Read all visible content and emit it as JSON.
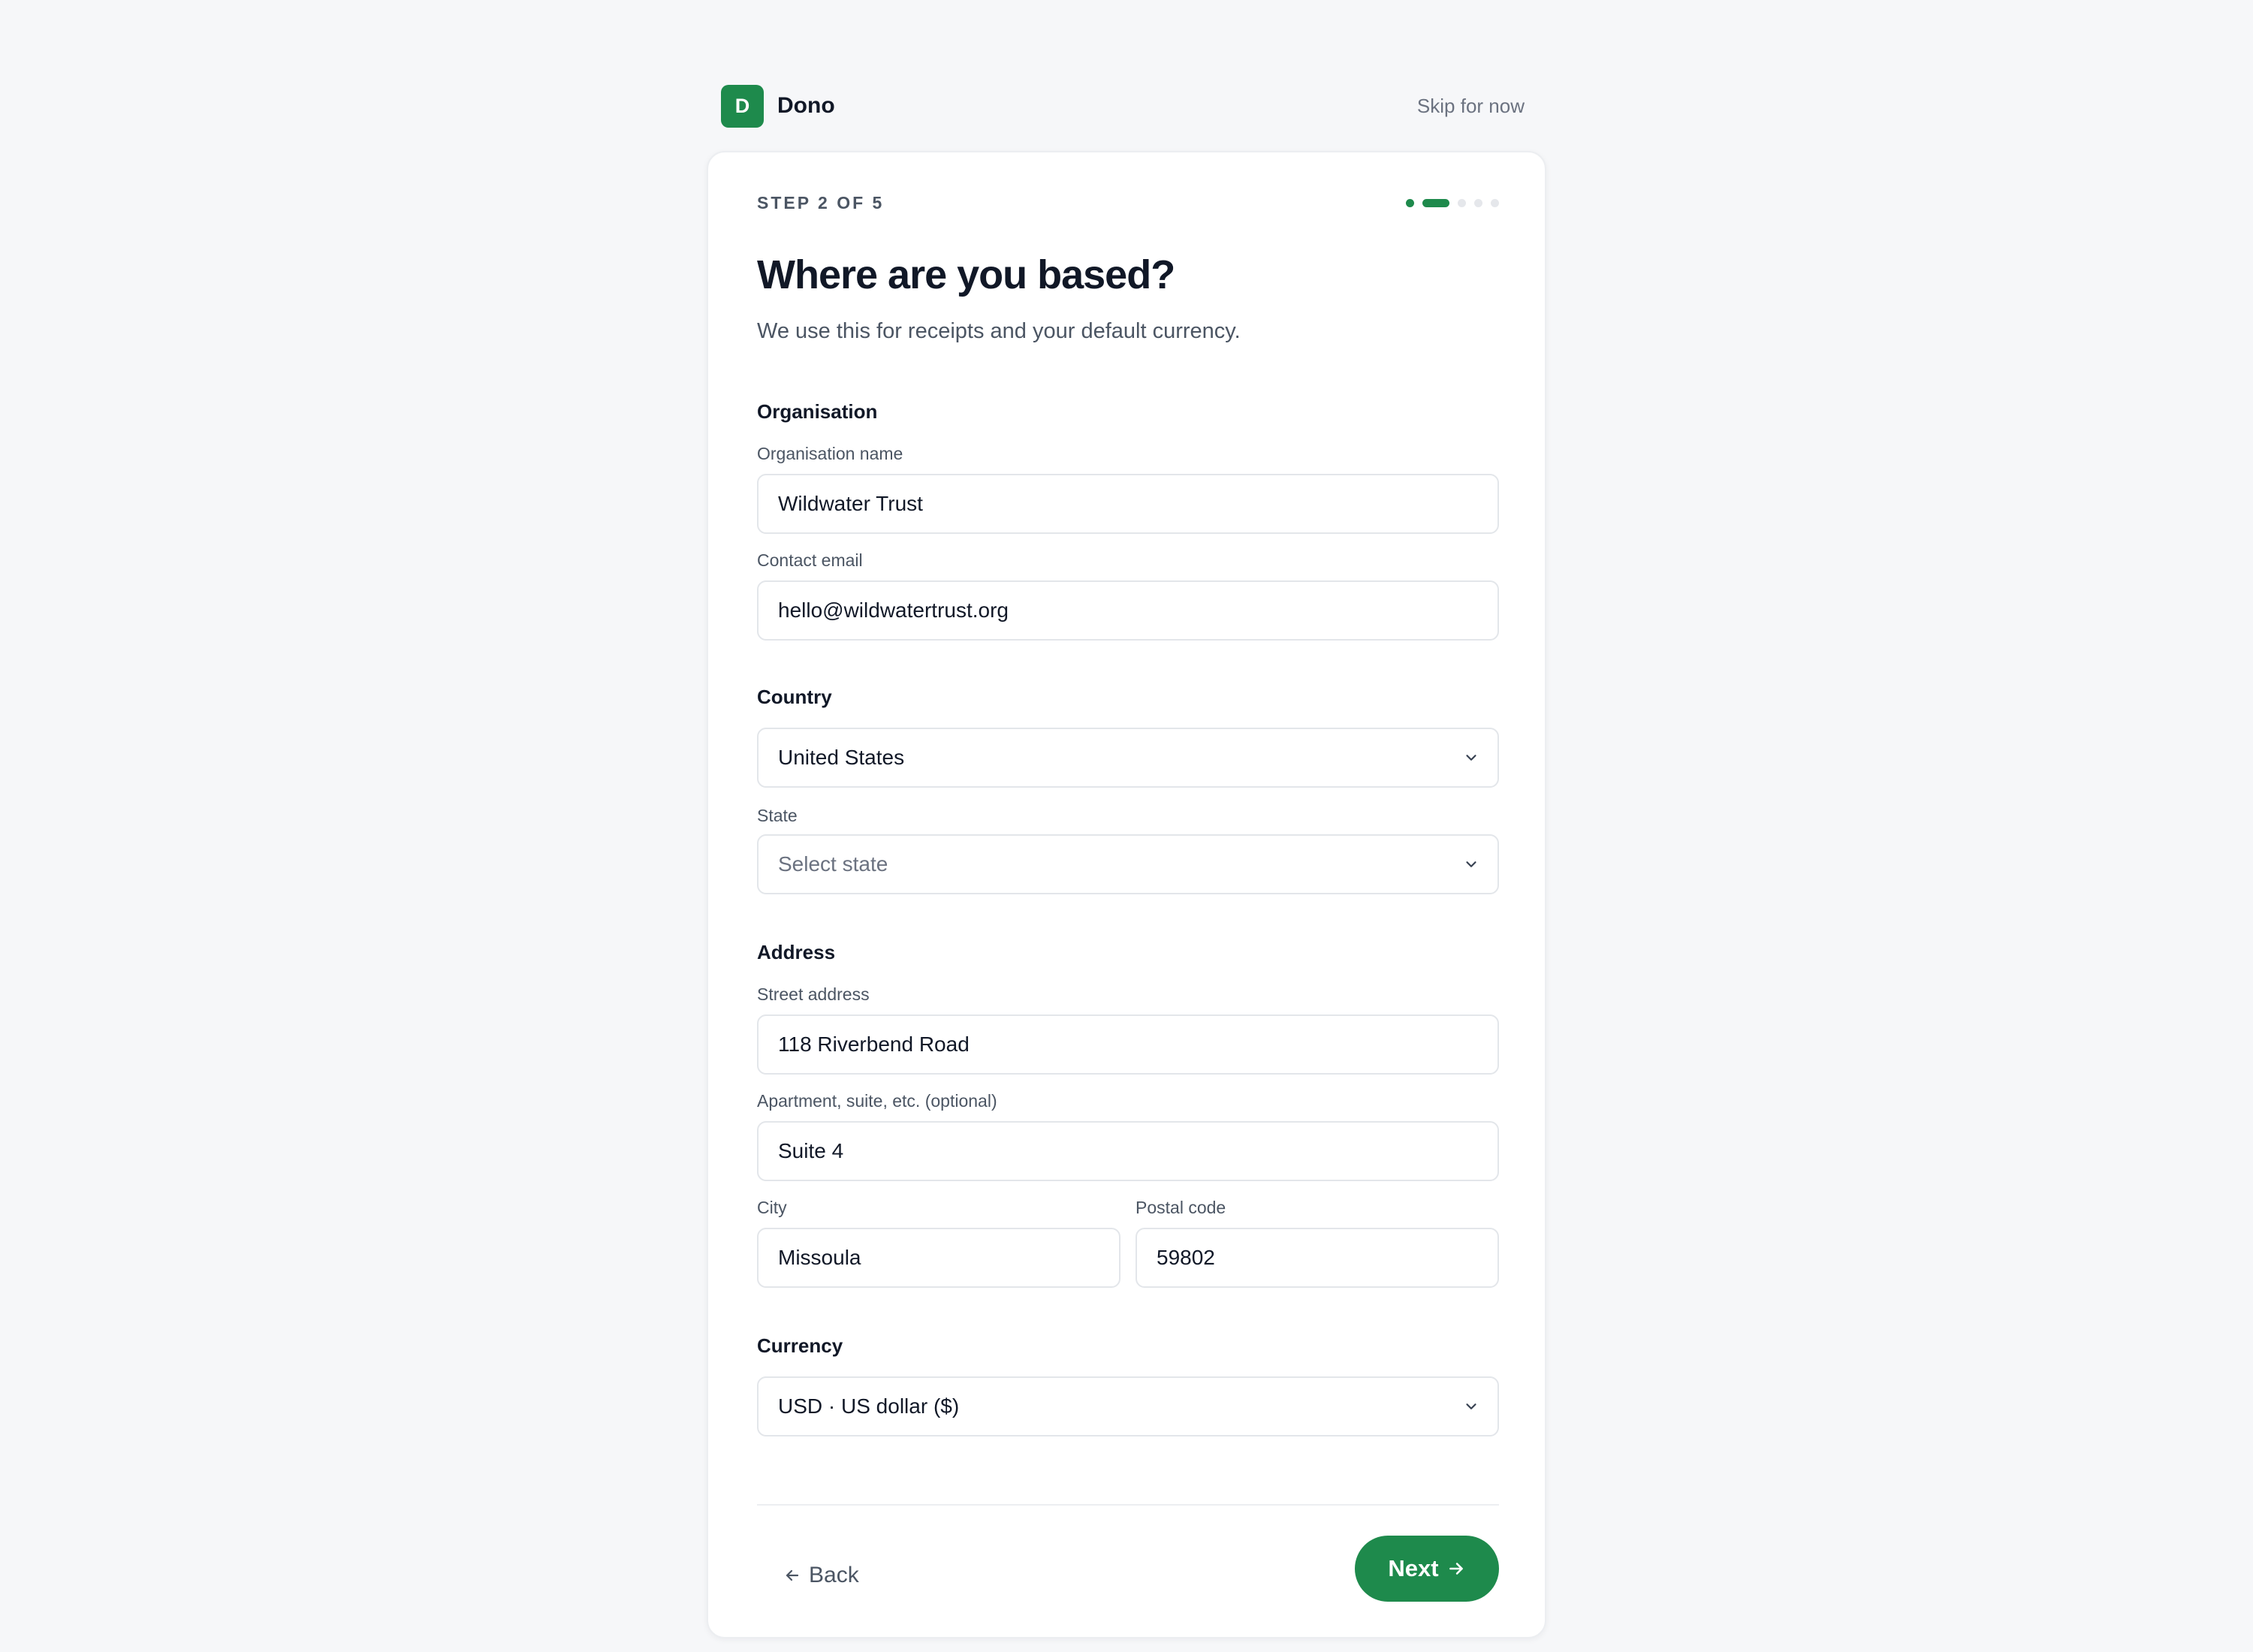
{
  "brand": {
    "logo_letter": "D",
    "name": "Dono"
  },
  "header": {
    "skip_label": "Skip for now"
  },
  "progress": {
    "step_label": "STEP 2 OF 5",
    "current_step": 2,
    "total_steps": 5
  },
  "page": {
    "title": "Where are you based?",
    "subtitle": "We use this for receipts and your default currency."
  },
  "organisation": {
    "heading": "Organisation",
    "name_label": "Organisation name",
    "name_value": "Wildwater Trust",
    "email_label": "Contact email",
    "email_value": "hello@wildwatertrust.org"
  },
  "country": {
    "heading": "Country",
    "selected": "United States",
    "state_label": "State",
    "state_placeholder": "Select state"
  },
  "address": {
    "heading": "Address",
    "street_label": "Street address",
    "street_value": "118 Riverbend Road",
    "apt_label": "Apartment, suite, etc. (optional)",
    "apt_value": "Suite 4",
    "city_label": "City",
    "city_value": "Missoula",
    "postal_label": "Postal code",
    "postal_value": "59802"
  },
  "currency": {
    "heading": "Currency",
    "selected": "USD · US dollar ($)"
  },
  "footer": {
    "back_label": "Back",
    "next_label": "Next"
  },
  "colors": {
    "accent": "#1e8a4c",
    "background": "#f6f7f9",
    "border": "#e3e6ea"
  }
}
